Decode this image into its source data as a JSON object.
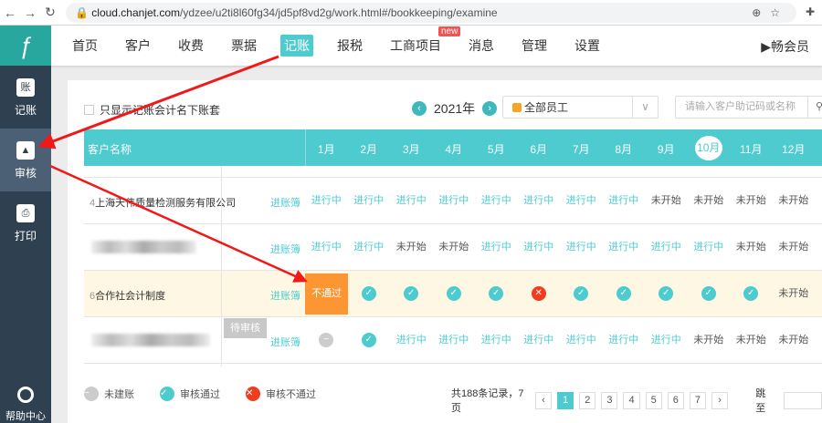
{
  "browser": {
    "url_host": "cloud.chanjet.com",
    "url_path": "/ydzee/u2ti8l60fg34/jd5pf8vd2g/work.html#/bookkeeping/examine"
  },
  "nav": {
    "logo": "ƒ",
    "items": [
      "首页",
      "客户",
      "收费",
      "票据",
      "记账",
      "报税",
      "工商项目",
      "消息",
      "管理",
      "设置"
    ],
    "active": 4,
    "new_badge": "new",
    "vip": "畅会员"
  },
  "sidebar": {
    "items": [
      {
        "icon": "账",
        "label": "记账"
      },
      {
        "icon": "▲",
        "label": "审核"
      },
      {
        "icon": "⎙",
        "label": "打印"
      }
    ],
    "active": 1,
    "help": "帮助中心"
  },
  "toolbar": {
    "checkbox_label": "只显示记账会计名下账套",
    "year": "2021年",
    "employee": "全部员工",
    "search_placeholder": "请输入客户助记码或名称"
  },
  "table": {
    "name_header": "客户名称",
    "months": [
      "1月",
      "2月",
      "3月",
      "4月",
      "5月",
      "6月",
      "7月",
      "8月",
      "9月",
      "10月",
      "11月",
      "12月"
    ],
    "current_month": 9,
    "ledger_label": "进账簿",
    "status_labels": {
      "ip": "进行中",
      "ns": "未开始",
      "fail": "不通过"
    },
    "rows": [
      {
        "num": "4",
        "name": "上海天伟质量检测服务有限公司",
        "cells": [
          "ip",
          "ip",
          "ip",
          "ip",
          "ip",
          "ip",
          "ip",
          "ip",
          "ns",
          "ns",
          "ns",
          "ns"
        ]
      },
      {
        "num": "",
        "name": "",
        "cells": [
          "ip",
          "ip",
          "ns",
          "ns",
          "ip",
          "ip",
          "ip",
          "ip",
          "ip",
          "ip",
          "ns",
          "ns"
        ]
      },
      {
        "num": "6",
        "name": "合作社会计制度",
        "highlight": true,
        "cells": [
          "fail",
          "ok",
          "ok",
          "ok",
          "ok",
          "x",
          "ok",
          "ok",
          "ok",
          "ok",
          "ok",
          "ns"
        ]
      },
      {
        "num": "",
        "name": "",
        "cells": [
          "no",
          "ok",
          "ip",
          "ip",
          "ip",
          "ip",
          "ip",
          "ip",
          "ip",
          "ns",
          "ns",
          "ns"
        ]
      }
    ],
    "tooltip": "待审核"
  },
  "legend": [
    {
      "type": "no",
      "label": "未建账"
    },
    {
      "type": "ok",
      "label": "审核通过"
    },
    {
      "type": "x",
      "label": "审核不通过"
    }
  ],
  "pager": {
    "summary": "共188条记录，7页",
    "pages": [
      "1",
      "2",
      "3",
      "4",
      "5",
      "6",
      "7"
    ],
    "current": "1",
    "jump_label": "跳至"
  }
}
